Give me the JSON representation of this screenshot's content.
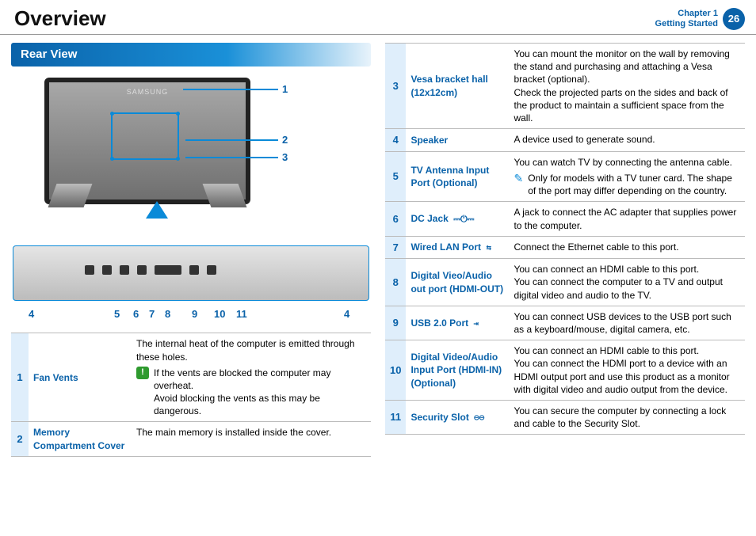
{
  "header": {
    "title": "Overview",
    "chapter_line1": "Chapter 1",
    "chapter_line2": "Getting Started",
    "page_number": "26"
  },
  "section": {
    "rear_view_title": "Rear View"
  },
  "diagram": {
    "brand": "SAMSUNG",
    "callouts_top": {
      "n1": "1",
      "n2": "2",
      "n3": "3"
    },
    "callouts_ports": {
      "p4l": "4",
      "p5": "5",
      "p6": "6",
      "p7": "7",
      "p8": "8",
      "p9": "9",
      "p10": "10",
      "p11": "11",
      "p4r": "4"
    }
  },
  "rows": [
    {
      "num": "1",
      "term": "Fan Vents",
      "desc": "The internal heat of the computer is emitted through these holes.",
      "warn": "If the vents are blocked the computer may overheat.\nAvoid blocking the vents as this may be dangerous."
    },
    {
      "num": "2",
      "term": "Memory Compartment Cover",
      "desc": "The main memory is installed inside the cover."
    },
    {
      "num": "3",
      "term": "Vesa bracket hall (12x12cm)",
      "desc": "You can mount the monitor on the wall by removing the stand and purchasing and attaching a Vesa bracket (optional).\nCheck the projected parts on the sides and back of the product to maintain a sufficient space from the wall."
    },
    {
      "num": "4",
      "term": "Speaker",
      "desc": "A device used to generate sound."
    },
    {
      "num": "5",
      "term": "TV Antenna Input Port (Optional)",
      "desc": "You can watch TV by connecting the antenna cable.",
      "memo": "Only for models with a TV tuner card. The shape of the port may differ depending on the country."
    },
    {
      "num": "6",
      "term": "DC Jack",
      "term_sym": "⎓⏻⎓",
      "desc": "A jack to connect the AC adapter that supplies power to the computer."
    },
    {
      "num": "7",
      "term": "Wired LAN Port",
      "term_sym": "⇆",
      "desc": "Connect the Ethernet cable to this port."
    },
    {
      "num": "8",
      "term": "Digital Vieo/Audio out port (HDMI-OUT)",
      "desc": "You can connect an HDMI cable to this port.\nYou can connect the computer to a TV and output digital video and audio to the TV."
    },
    {
      "num": "9",
      "term": "USB 2.0 Port",
      "term_sym": "⇥",
      "desc": "You can connect USB devices to the USB port such as a keyboard/mouse, digital camera, etc."
    },
    {
      "num": "10",
      "term": "Digital Video/Audio Input Port (HDMI-IN) (Optional)",
      "desc": "You can connect an HDMI cable to this port.\nYou can connect the HDMI port to a device with an HDMI output port and use this product as a monitor with digital video and audio output from the device."
    },
    {
      "num": "11",
      "term": "Security Slot",
      "term_sym": "⊖⊖",
      "desc": "You can secure the computer by connecting a lock and cable to the Security Slot."
    }
  ]
}
